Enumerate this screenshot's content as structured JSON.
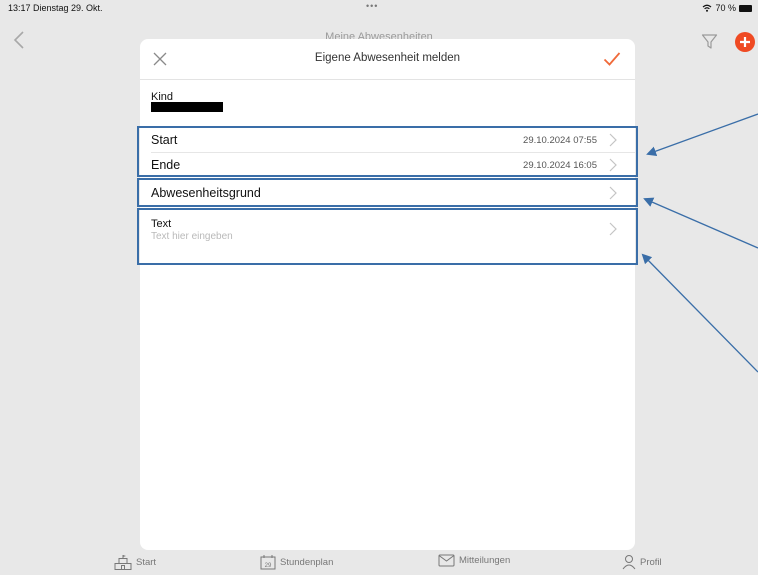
{
  "status": {
    "time_date": "13:17  Dienstag 29. Okt.",
    "dots": "•••",
    "battery": "70 %"
  },
  "background": {
    "title": "Meine Abwesenheiten"
  },
  "modal": {
    "title": "Eigene Abwesenheit melden",
    "kind_label": "Kind",
    "start_label": "Start",
    "start_value": "29.10.2024 07:55",
    "ende_label": "Ende",
    "ende_value": "29.10.2024 16:05",
    "grund_label": "Abwesenheitsgrund",
    "text_label": "Text",
    "text_placeholder": "Text hier eingeben"
  },
  "tabbar": {
    "items": [
      {
        "label": "Start",
        "icon": "school-icon"
      },
      {
        "label": "Stundenplan",
        "icon": "calendar-icon",
        "icon_text": "29"
      },
      {
        "label": "Mitteilungen",
        "icon": "mail-icon"
      },
      {
        "label": "Profil",
        "icon": "person-icon"
      }
    ]
  },
  "colors": {
    "accent": "#f06a3a",
    "annotation": "#3a6ea8",
    "add_button": "#ef4a23"
  }
}
